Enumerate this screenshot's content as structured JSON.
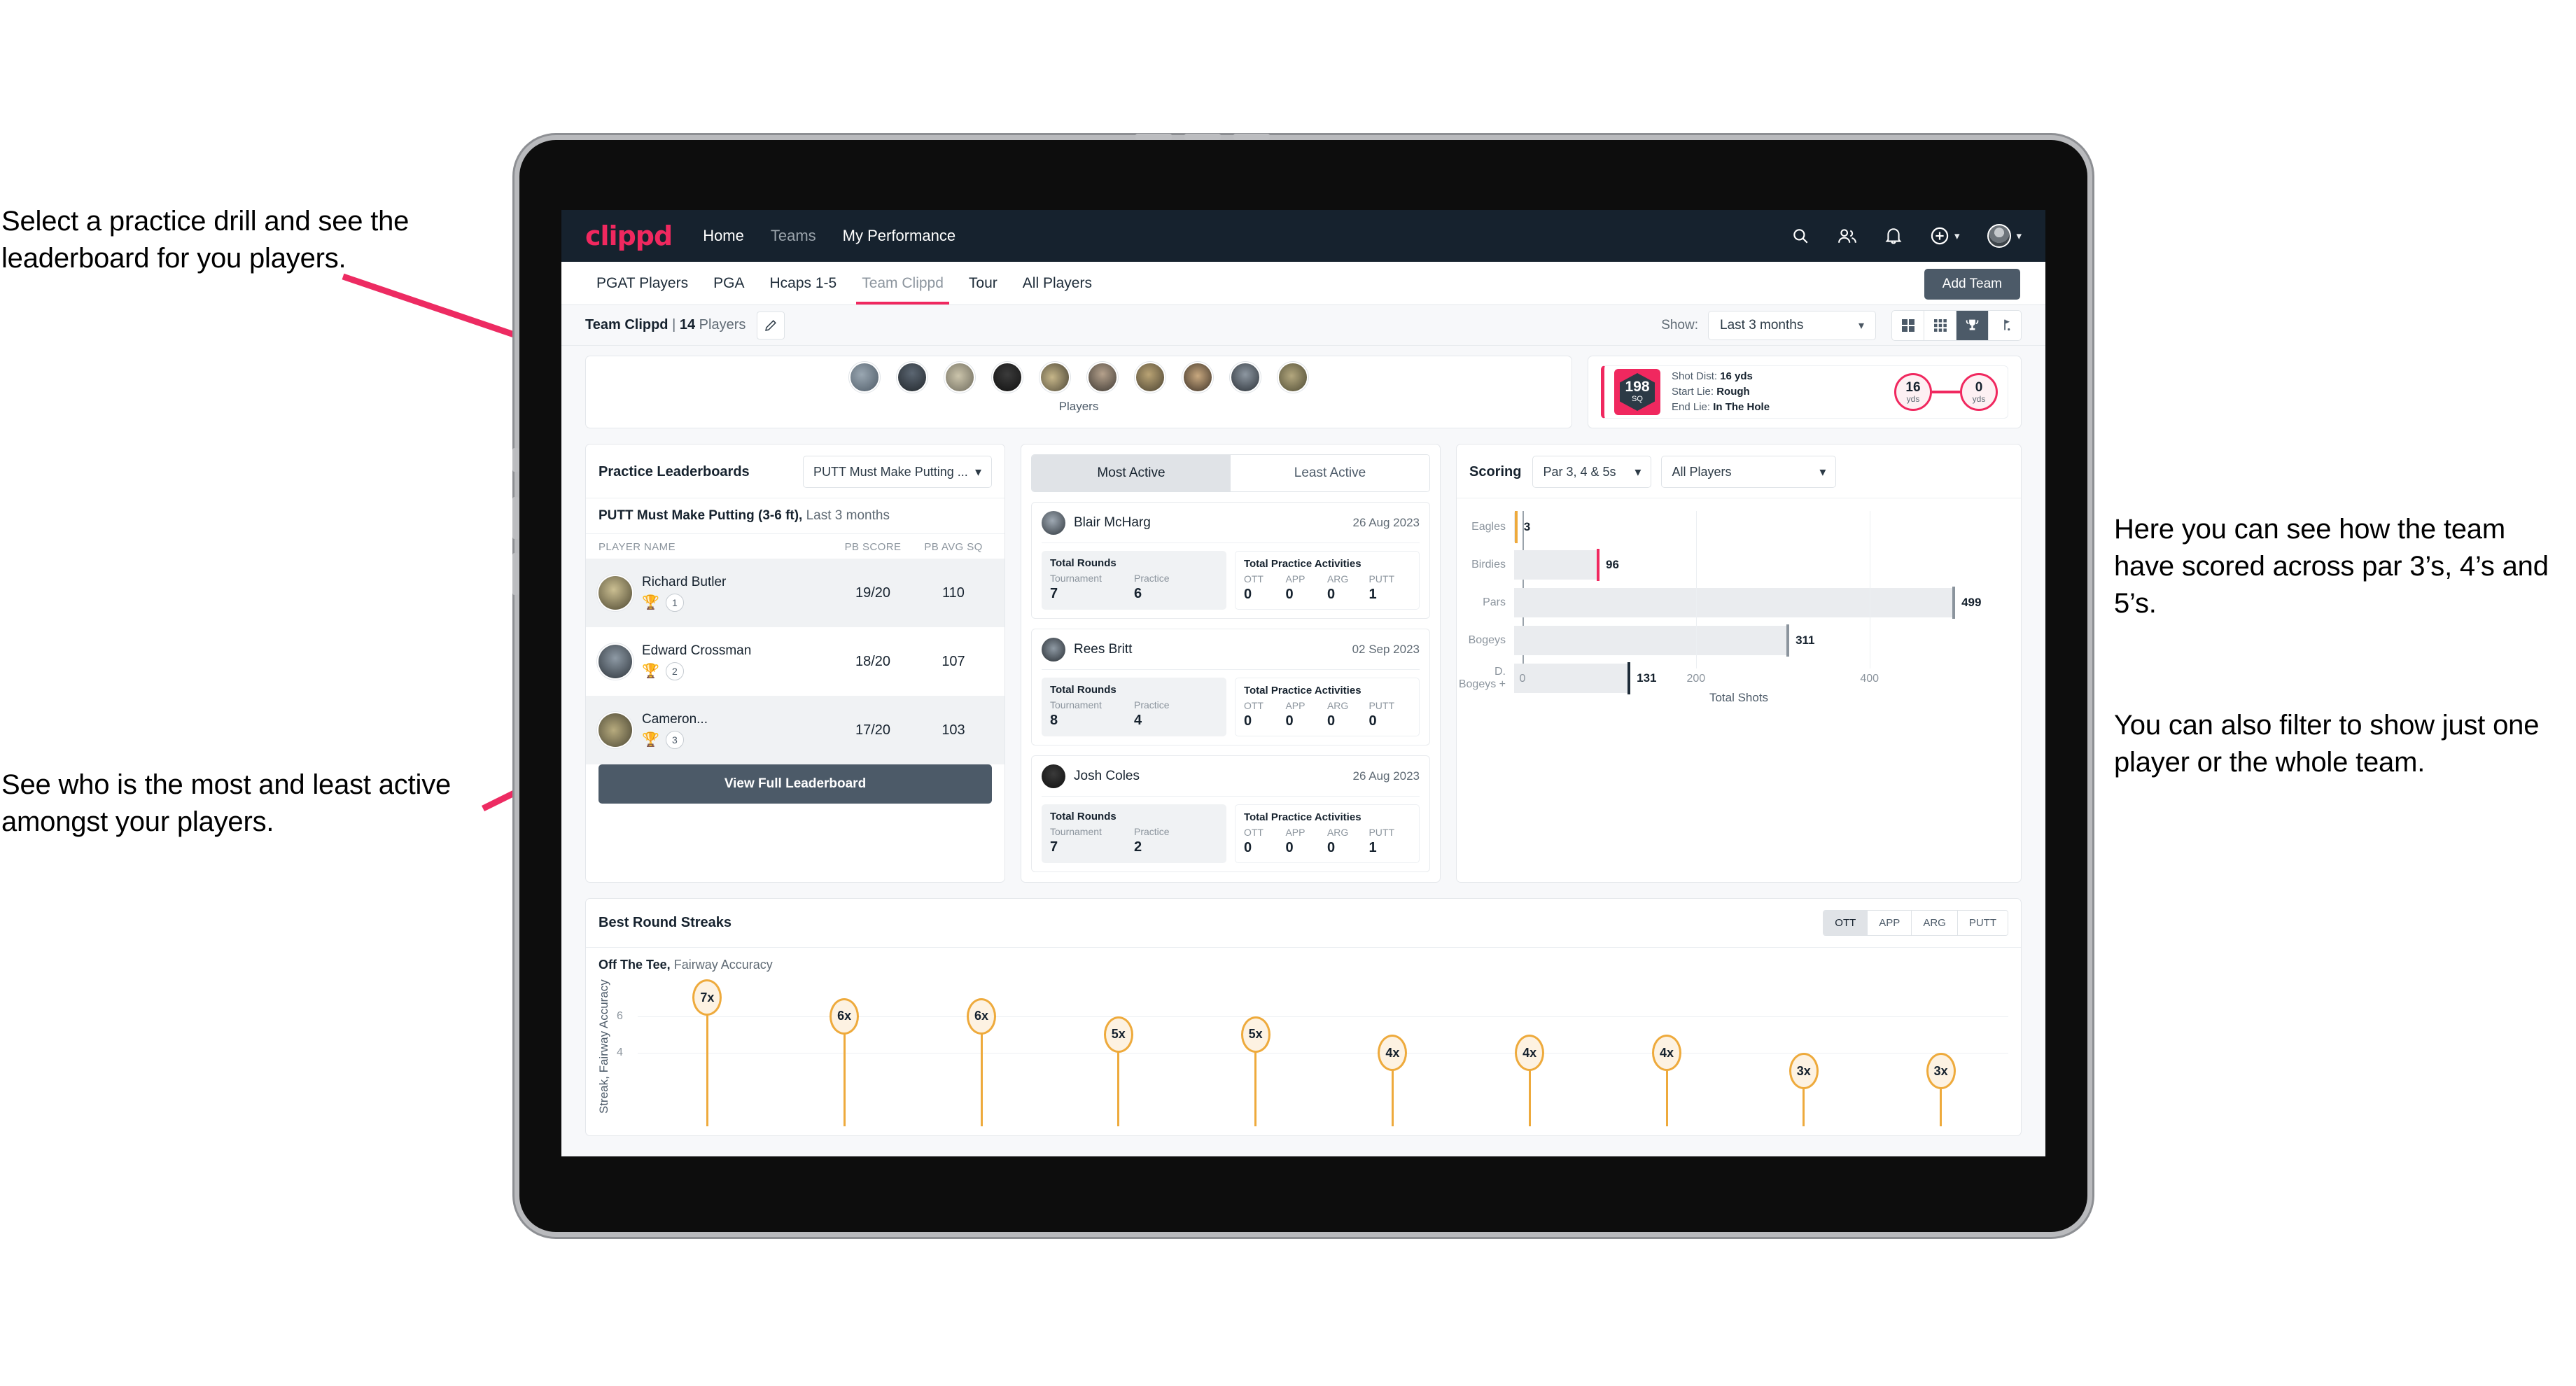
{
  "annotations": {
    "top_left": "Select a practice drill and see the leaderboard for you players.",
    "mid_left": "See who is the most and least active amongst your players.",
    "right_1": "Here you can see how the team have scored across par 3’s, 4’s and 5’s.",
    "right_2": "You can also filter to show just one player or the whole team.",
    "accent_color": "#ed2b62"
  },
  "header": {
    "logo": "clippd",
    "nav": [
      {
        "label": "Home",
        "active": true
      },
      {
        "label": "Teams",
        "active": false
      },
      {
        "label": "My Performance",
        "active": true
      }
    ],
    "icons": [
      {
        "name": "search-icon"
      },
      {
        "name": "people-icon"
      },
      {
        "name": "bell-icon"
      },
      {
        "name": "plus-circle-icon"
      },
      {
        "name": "avatar-icon"
      }
    ]
  },
  "tabs": [
    {
      "label": "PGAT Players",
      "active": false
    },
    {
      "label": "PGA",
      "active": false
    },
    {
      "label": "Hcaps 1-5",
      "active": false
    },
    {
      "label": "Team Clippd",
      "active": true
    },
    {
      "label": "Tour",
      "active": false
    },
    {
      "label": "All Players",
      "active": false
    }
  ],
  "add_team_button": "Add Team",
  "toolbar": {
    "team_name": "Team Clippd",
    "separator": "|",
    "player_count": "14",
    "players_word": "Players",
    "edit_icon": "pencil-icon",
    "show_label": "Show:",
    "range_value": "Last 3 months",
    "view_modes": [
      {
        "name": "grid-large-icon",
        "active": false
      },
      {
        "name": "grid-small-icon",
        "active": false
      },
      {
        "name": "trophy-icon",
        "active": true
      },
      {
        "name": "flag-icon",
        "active": false
      }
    ]
  },
  "players_strip": {
    "caption": "Players",
    "count": 10
  },
  "shot_card": {
    "sq_value": "198",
    "sq_label": "SQ",
    "lines": [
      {
        "label": "Shot Dist:",
        "value": "16 yds"
      },
      {
        "label": "Start Lie:",
        "value": "Rough"
      },
      {
        "label": "End Lie:",
        "value": "In The Hole"
      }
    ],
    "start_dist": "16",
    "start_unit": "yds",
    "end_dist": "0",
    "end_unit": "yds"
  },
  "leaderboard": {
    "title": "Practice Leaderboards",
    "drill_select": "PUTT Must Make Putting ...",
    "subtitle_bold": "PUTT Must Make Putting (3-6 ft),",
    "subtitle_thin": "Last 3 months",
    "columns": [
      "PLAYER NAME",
      "PB SCORE",
      "PB AVG SQ"
    ],
    "rows": [
      {
        "name": "Richard Butler",
        "rank": "1",
        "trophy": "gold",
        "score": "19/20",
        "avg_sq": "110",
        "highlight": true
      },
      {
        "name": "Edward Crossman",
        "rank": "2",
        "trophy": "silver",
        "score": "18/20",
        "avg_sq": "107",
        "highlight": false
      },
      {
        "name": "Cameron...",
        "rank": "3",
        "trophy": "bronze",
        "score": "17/20",
        "avg_sq": "103",
        "highlight": true
      }
    ],
    "button": "View Full Leaderboard"
  },
  "activity": {
    "tabs": [
      {
        "label": "Most Active",
        "active": true
      },
      {
        "label": "Least Active",
        "active": false
      }
    ],
    "rounds_title": "Total Rounds",
    "rounds_labels": [
      "Tournament",
      "Practice"
    ],
    "acts_title": "Total Practice Activities",
    "acts_labels": [
      "OTT",
      "APP",
      "ARG",
      "PUTT"
    ],
    "cards": [
      {
        "name": "Blair McHarg",
        "date": "26 Aug 2023",
        "rounds": [
          "7",
          "6"
        ],
        "acts": [
          "0",
          "0",
          "0",
          "1"
        ]
      },
      {
        "name": "Rees Britt",
        "date": "02 Sep 2023",
        "rounds": [
          "8",
          "4"
        ],
        "acts": [
          "0",
          "0",
          "0",
          "0"
        ]
      },
      {
        "name": "Josh Coles",
        "date": "26 Aug 2023",
        "rounds": [
          "7",
          "2"
        ],
        "acts": [
          "0",
          "0",
          "0",
          "1"
        ]
      }
    ]
  },
  "scoring": {
    "title": "Scoring",
    "par_select": "Par 3, 4 & 5s",
    "player_select": "All Players"
  },
  "chart_data": [
    {
      "type": "bar",
      "orientation": "horizontal",
      "title": "Scoring",
      "categories": [
        "Eagles",
        "Birdies",
        "Pars",
        "Bogeys",
        "D. Bogeys +"
      ],
      "values": [
        3,
        96,
        499,
        311,
        131
      ],
      "cap_colors": [
        "#eeaa3c",
        "#f0285f",
        "#8b949d",
        "#8b949d",
        "#1d2b38"
      ],
      "xlabel": "Total Shots",
      "ylabel": "",
      "xticks": [
        0,
        200,
        400
      ],
      "xlim": [
        0,
        560
      ],
      "grid": true,
      "legend": "none"
    },
    {
      "type": "lollipop",
      "title": "Best Round Streaks",
      "subtitle_bold": "Off The Tee,",
      "subtitle_thin": "Fairway Accuracy",
      "ylabel": "Streak, Fairway Accuracy",
      "yticks": [
        4,
        6
      ],
      "ylim": [
        0,
        8
      ],
      "values": [
        7,
        6,
        6,
        5,
        5,
        4,
        4,
        4,
        3,
        3
      ],
      "labels": [
        "7x",
        "6x",
        "6x",
        "5x",
        "5x",
        "4x",
        "4x",
        "4x",
        "3x",
        "3x"
      ],
      "grid": true,
      "series_color": "#eeaa3c",
      "toggle": [
        {
          "label": "OTT",
          "active": true
        },
        {
          "label": "APP",
          "active": false
        },
        {
          "label": "ARG",
          "active": false
        },
        {
          "label": "PUTT",
          "active": false
        }
      ]
    }
  ]
}
